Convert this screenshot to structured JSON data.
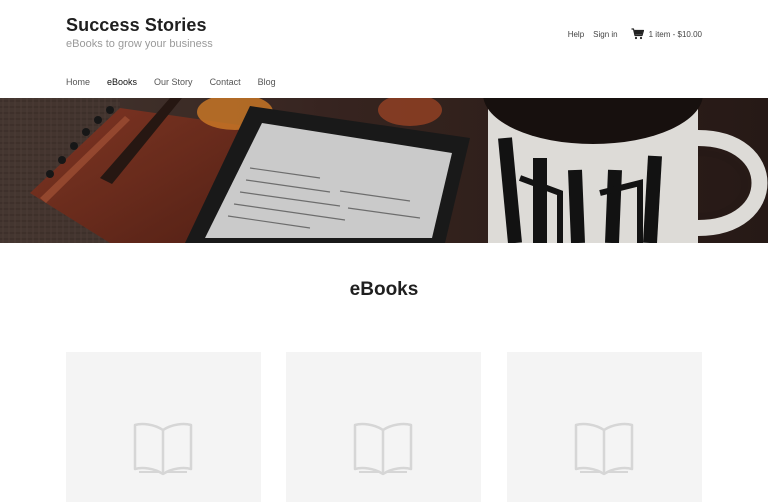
{
  "site": {
    "title": "Success Stories",
    "tagline": "eBooks to grow your business"
  },
  "top_links": {
    "help": "Help",
    "sign_in": "Sign in",
    "cart": "1 item - $10.00"
  },
  "nav": {
    "items": [
      {
        "label": "Home",
        "active": false
      },
      {
        "label": "eBooks",
        "active": true
      },
      {
        "label": "Our Story",
        "active": false
      },
      {
        "label": "Contact",
        "active": false
      },
      {
        "label": "Blog",
        "active": false
      }
    ]
  },
  "main": {
    "section_title": "eBooks"
  },
  "colors": {
    "card_background": "#f4f4f4",
    "placeholder_icon": "#d6d6d6",
    "title_text": "#1f1f1f",
    "tagline_text": "#9a9a9a"
  },
  "icons": {
    "cart": "shopping-cart-icon",
    "card_placeholder": "open-book-icon"
  }
}
